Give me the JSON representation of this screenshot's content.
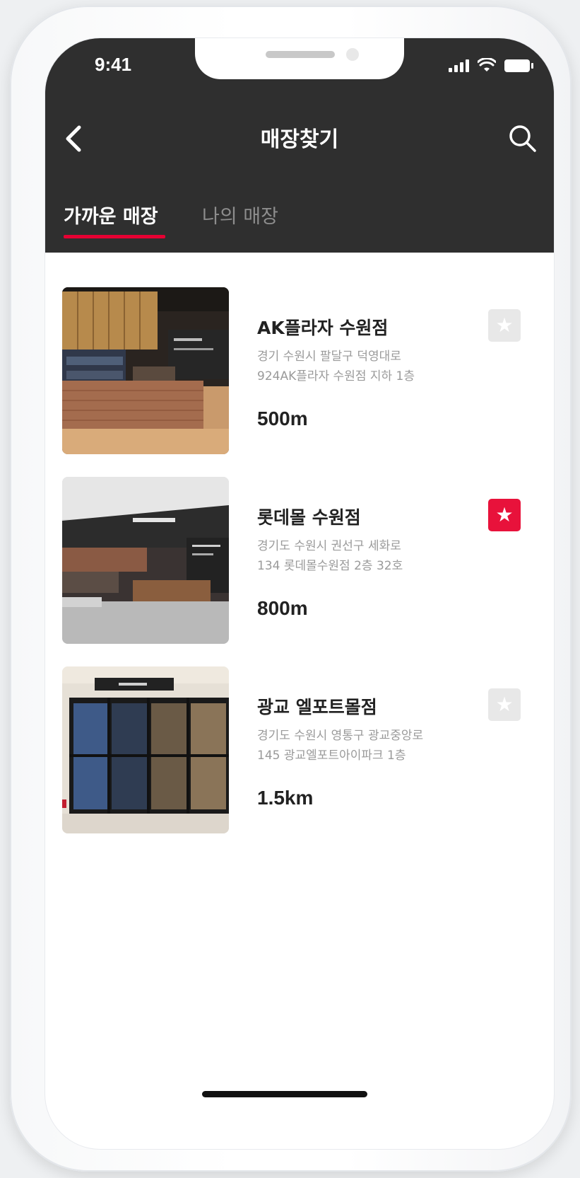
{
  "status_bar": {
    "time": "9:41"
  },
  "header": {
    "title": "매장찾기"
  },
  "tabs": [
    {
      "label": "가까운 매장",
      "active": true
    },
    {
      "label": "나의 매장",
      "active": false
    }
  ],
  "stores": [
    {
      "name": "AK플라자 수원점",
      "address_line1": "경기 수원시 팔달구 덕영대로",
      "address_line2": "924AK플라자 수원점 지하 1층",
      "distance": "500m",
      "favorite": false
    },
    {
      "name": "롯데몰 수원점",
      "address_line1": "경기도 수원시 권선구 세화로",
      "address_line2": "134 롯데몰수원점 2층 32호",
      "distance": "800m",
      "favorite": true
    },
    {
      "name": "광교 엘포트몰점",
      "address_line1": "경기도 수원시 영통구 광교중앙로",
      "address_line2": "145 광교엘포트아이파크 1층",
      "distance": "1.5km",
      "favorite": false
    }
  ],
  "icons": {
    "back": "chevron-left-icon",
    "search": "search-icon",
    "favorite": "star-icon",
    "signal": "signal-icon",
    "wifi": "wifi-icon",
    "battery": "battery-icon"
  },
  "colors": {
    "header_bg": "#2f2f2f",
    "accent": "#e8123b",
    "favorite_off": "#e8e8e8",
    "text_primary": "#222222",
    "text_secondary": "#9a9a9a"
  }
}
